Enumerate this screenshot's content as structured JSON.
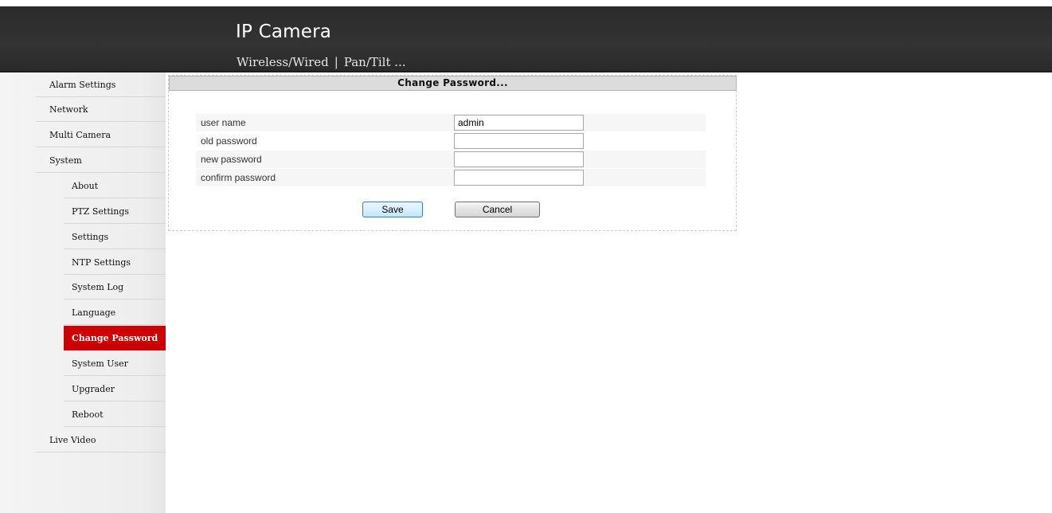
{
  "header": {
    "title": "IP Camera",
    "subtitle_left": "Wireless/Wired",
    "subtitle_separator": "|",
    "subtitle_right": "Pan/Tilt ..."
  },
  "sidebar": {
    "top_items": [
      {
        "label": "Alarm Settings"
      },
      {
        "label": "Network"
      },
      {
        "label": "Multi Camera"
      },
      {
        "label": "System"
      },
      {
        "label": "Live Video"
      }
    ],
    "system_items": [
      {
        "label": "About"
      },
      {
        "label": "PTZ Settings"
      },
      {
        "label": "Settings"
      },
      {
        "label": "NTP Settings"
      },
      {
        "label": "System Log"
      },
      {
        "label": "Language"
      },
      {
        "label": "Change Password",
        "active": true
      },
      {
        "label": "System User"
      },
      {
        "label": "Upgrader"
      },
      {
        "label": "Reboot"
      }
    ]
  },
  "main": {
    "panel_title": "Change Password...",
    "form": {
      "fields": [
        {
          "label": "user name",
          "value": "admin"
        },
        {
          "label": "old password",
          "value": ""
        },
        {
          "label": "new password",
          "value": ""
        },
        {
          "label": "confirm password",
          "value": ""
        }
      ],
      "save_label": "Save",
      "cancel_label": "Cancel"
    }
  },
  "colors": {
    "header_bg": "#333333",
    "active_nav_bg": "#cc0000",
    "panel_title_bg": "#dcdcdc"
  }
}
